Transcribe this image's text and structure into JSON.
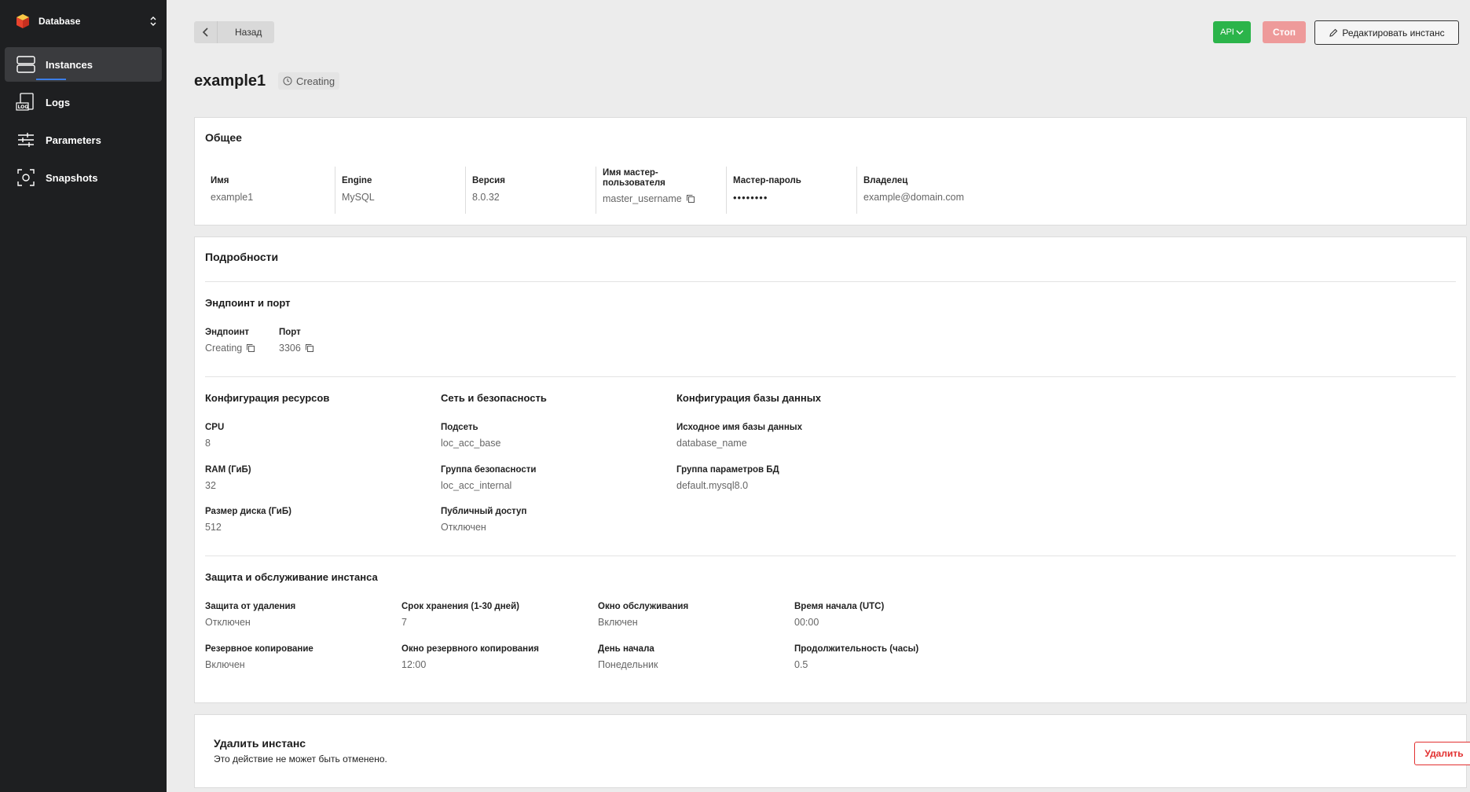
{
  "sidebar": {
    "brand": "Database",
    "items": [
      {
        "label": "Instances"
      },
      {
        "label": "Logs"
      },
      {
        "label": "Parameters"
      },
      {
        "label": "Snapshots"
      }
    ]
  },
  "header": {
    "back_label": "Назад",
    "api_label": "API",
    "stop_label": "Стоп",
    "edit_label": "Редактировать инстанс"
  },
  "instance": {
    "name": "example1",
    "status": "Creating"
  },
  "general": {
    "title": "Общее",
    "fields": [
      {
        "label": "Имя",
        "value": "example1"
      },
      {
        "label": "Engine",
        "value": "MySQL"
      },
      {
        "label": "Версия",
        "value": "8.0.32"
      },
      {
        "label": "Имя мастер-пользователя",
        "value": "master_username"
      },
      {
        "label": "Мастер-пароль",
        "value": "••••••••"
      },
      {
        "label": "Владелец",
        "value": "example@domain.com"
      }
    ]
  },
  "details": {
    "title": "Подробности",
    "endpoint_section": {
      "title": "Эндпоинт и порт",
      "endpoint_label": "Эндпоинт",
      "endpoint_value": "Creating",
      "port_label": "Порт",
      "port_value": "3306"
    },
    "resources": {
      "title": "Конфигурация ресурсов",
      "fields": [
        {
          "label": "CPU",
          "value": "8"
        },
        {
          "label": "RAM (ГиБ)",
          "value": "32"
        },
        {
          "label": "Размер диска (ГиБ)",
          "value": "512"
        }
      ]
    },
    "network": {
      "title": "Сеть и безопасность",
      "fields": [
        {
          "label": "Подсеть",
          "value": "loc_acc_base"
        },
        {
          "label": "Группа безопасности",
          "value": "loc_acc_internal"
        },
        {
          "label": "Публичный доступ",
          "value": "Отключен"
        }
      ]
    },
    "db_config": {
      "title": "Конфигурация базы данных",
      "fields": [
        {
          "label": "Исходное имя базы данных",
          "value": "database_name"
        },
        {
          "label": "Группа параметров БД",
          "value": "default.mysql8.0"
        }
      ]
    },
    "protection": {
      "title": "Защита и обслуживание инстанса",
      "fields": [
        {
          "label": "Защита от удаления",
          "value": "Отключен"
        },
        {
          "label": "Срок хранения (1-30 дней)",
          "value": "7"
        },
        {
          "label": "Окно обслуживания",
          "value": "Включен"
        },
        {
          "label": "Время начала (UTC)",
          "value": "00:00"
        },
        {
          "label": "Резервное копирование",
          "value": "Включен"
        },
        {
          "label": "Окно резервного копирования",
          "value": "12:00"
        },
        {
          "label": "День начала",
          "value": "Понедельник"
        },
        {
          "label": "Продолжительность (часы)",
          "value": "0.5"
        }
      ]
    }
  },
  "delete": {
    "title": "Удалить инстанс",
    "description": "Это действие не может быть отменено.",
    "button_label": "Удалить"
  },
  "colors": {
    "sidebar_bg": "#1e1f21",
    "api_green": "#2bb44a",
    "stop_red": "#ee9a9a",
    "delete_red": "#e23030",
    "active_underline": "#3b7ee8"
  }
}
